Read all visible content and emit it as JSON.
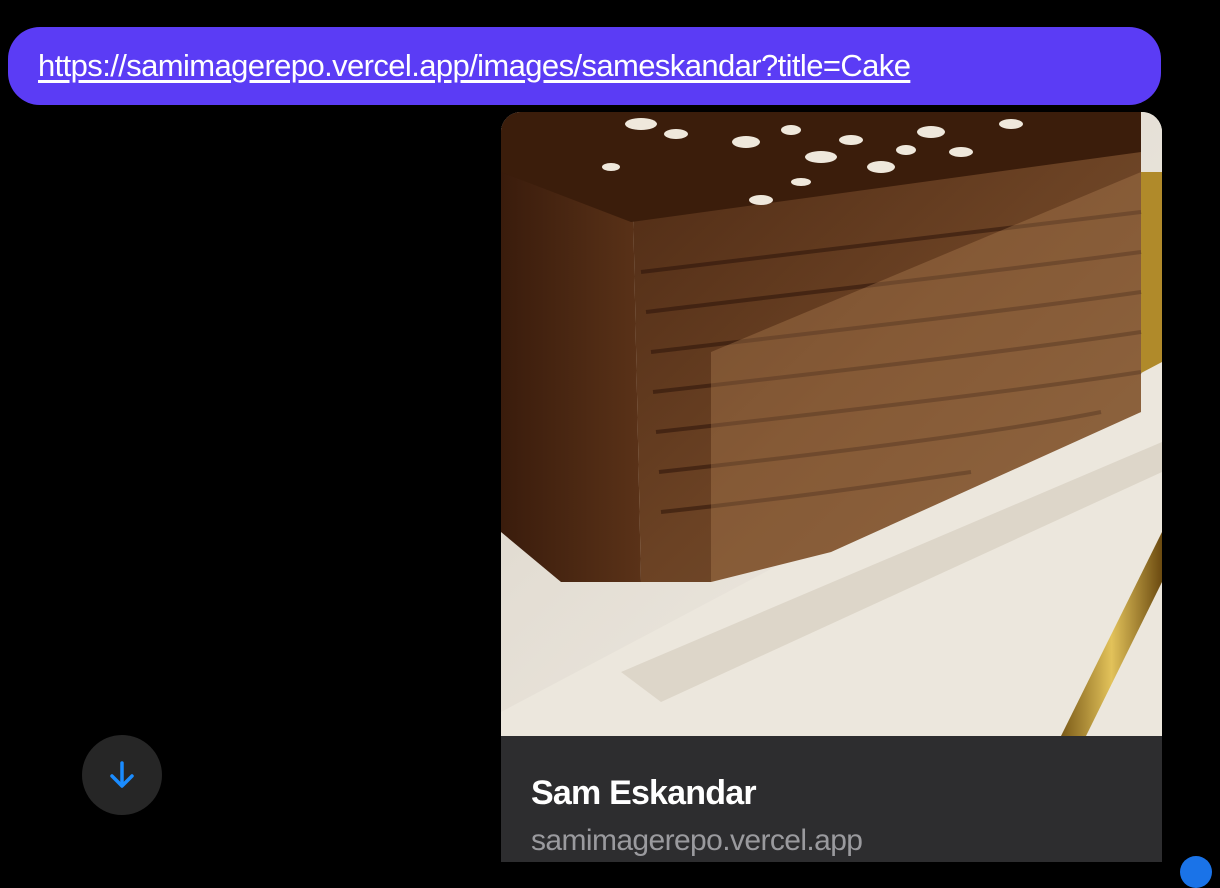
{
  "message": {
    "link_text": "https://samimagerepo.vercel.app/images/sameskandar?title=Cake",
    "bubble_color": "#5b3cf5"
  },
  "link_preview": {
    "image_description_icon": "cake-photo",
    "title": "Sam Eskandar",
    "domain": "samimagerepo.vercel.app"
  },
  "controls": {
    "scroll_down_icon": "arrow-down-icon",
    "accent_color": "#1a73e8"
  }
}
